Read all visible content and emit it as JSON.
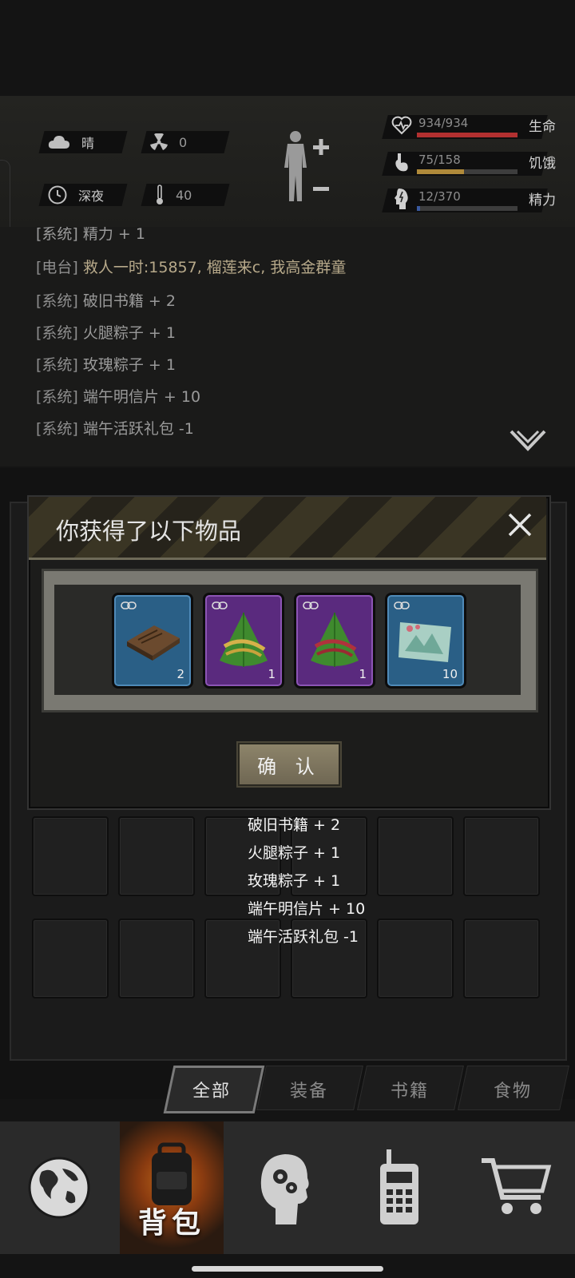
{
  "header": {
    "weather": {
      "icon": "cloud-icon",
      "label": "晴"
    },
    "radiation": {
      "icon": "radiation-icon",
      "value": "0"
    },
    "time": {
      "icon": "clock-icon",
      "label": "深夜"
    },
    "temperature": {
      "icon": "thermometer-icon",
      "value": "40"
    },
    "stats": [
      {
        "name": "生命",
        "value": "934/934",
        "fraction": 1.0,
        "color": "#b23030",
        "icon": "heart-icon"
      },
      {
        "name": "饥饿",
        "value": "75/158",
        "fraction": 0.47,
        "color": "#b08a3a",
        "icon": "stomach-icon"
      },
      {
        "name": "精力",
        "value": "12/370",
        "fraction": 0.03,
        "color": "#3a5aa0",
        "icon": "energy-icon"
      }
    ]
  },
  "log": {
    "partial_line": "[系统] 精力 + 1",
    "lines": [
      {
        "tag": "[电台]",
        "text": "救人一时:15857, 榴莲来c, 我高金群童",
        "radio": true
      },
      {
        "tag": "[系统]",
        "text": "破旧书籍 + 2"
      },
      {
        "tag": "[系统]",
        "text": "火腿粽子 + 1"
      },
      {
        "tag": "[系统]",
        "text": "玫瑰粽子 + 1"
      },
      {
        "tag": "[系统]",
        "text": "端午明信片 + 10"
      },
      {
        "tag": "[系统]",
        "text": "端午活跃礼包 -1"
      }
    ]
  },
  "modal": {
    "title": "你获得了以下物品",
    "confirm_label": "确 认",
    "items": [
      {
        "name": "破旧书籍",
        "count": "2",
        "rarity": "blue",
        "icon": "old-book-icon"
      },
      {
        "name": "火腿粽子",
        "count": "1",
        "rarity": "purple",
        "icon": "zongzi-icon"
      },
      {
        "name": "玫瑰粽子",
        "count": "1",
        "rarity": "purple",
        "icon": "zongzi-icon"
      },
      {
        "name": "端午明信片",
        "count": "10",
        "rarity": "blue",
        "icon": "postcard-icon"
      }
    ]
  },
  "toast": [
    "破旧书籍 + 2",
    "火腿粽子 + 1",
    "玫瑰粽子 + 1",
    "端午明信片 + 10",
    "端午活跃礼包 -1"
  ],
  "tabs": [
    {
      "label": "全部",
      "active": true
    },
    {
      "label": "装备",
      "active": false
    },
    {
      "label": "书籍",
      "active": false
    },
    {
      "label": "食物",
      "active": false
    }
  ],
  "nav": [
    {
      "icon": "globe-icon",
      "label": ""
    },
    {
      "icon": "backpack-icon",
      "label": "背包",
      "active": true
    },
    {
      "icon": "head-gears-icon",
      "label": ""
    },
    {
      "icon": "radio-icon",
      "label": ""
    },
    {
      "icon": "cart-icon",
      "label": ""
    }
  ]
}
